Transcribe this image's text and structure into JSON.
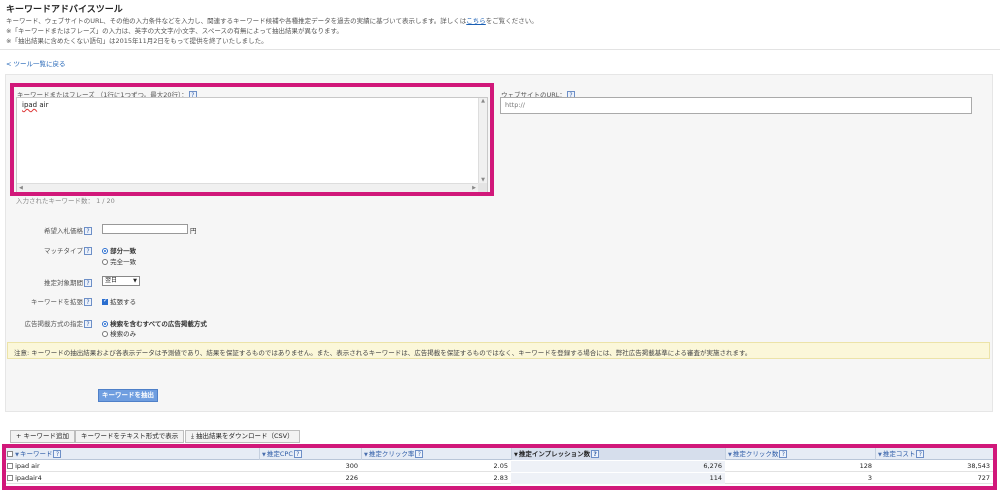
{
  "header": {
    "title": "キーワードアドバイスツール",
    "desc1": "キーワード、ウェブサイトのURL、その他の入力条件などを入力し、関連するキーワード候補や各種推定データを過去の実績に基づいて表示します。詳しくは",
    "desc1_link": "こちら",
    "desc1_tail": "をご覧ください。",
    "desc2": "※「キーワードまたはフレーズ」の入力は、英字の大文字/小文字、スペースの有無によって抽出結果が異なります。",
    "desc3": "※「抽出結果に含めたくない語句」は2015年11月2日をもって提供を終了いたしました。",
    "back_link": "< ツール一覧に戻る"
  },
  "keyword_input": {
    "label": "キーワードまたはフレーズ （1行に1つずつ。最大20行）：",
    "help": "?",
    "value_underlined": "ipad",
    "value_rest": " air",
    "count_text": "入力されたキーワード数： 1 / 20"
  },
  "website": {
    "label": "ウェブサイトのURL：",
    "help": "?",
    "placeholder": "http://"
  },
  "form": {
    "bid_label": "希望入札価格",
    "bid_unit": "円",
    "match_label": "マッチタイプ",
    "match_partial": "部分一致",
    "match_exact": "完全一致",
    "period_label": "推定対象期間",
    "period_value": "翌日",
    "expand_label": "キーワードを拡張",
    "expand_option": "拡張する",
    "ad_format_label": "広告掲載方式の指定",
    "ad_format_all": "検索を含むすべての広告掲載方式",
    "ad_format_search": "検索のみ",
    "help": "?"
  },
  "notice": "注意: キーワードの抽出結果および各表示データは予測値であり、結果を保証するものではありません。また、表示されるキーワードは、広告掲載を保証するものではなく、キーワードを登録する場合には、弊社広告掲載基準による審査が実施されます。",
  "extract_button": "キーワードを抽出",
  "toolbar": {
    "add": "キーワード追加",
    "text_view": "キーワードをテキスト形式で表示",
    "download": "抽出結果をダウンロード（CSV）"
  },
  "table": {
    "headers": [
      "キーワード",
      "推定CPC",
      "推定クリック率",
      "推定インプレッション数",
      "推定クリック数",
      "推定コスト"
    ],
    "help": "?",
    "rows": [
      [
        "ipad air",
        "300",
        "2.05",
        "6,276",
        "128",
        "38,543"
      ],
      [
        "ipadair4",
        "226",
        "2.83",
        "114",
        "3",
        "727"
      ]
    ]
  },
  "colors": {
    "highlight": "#d1187a",
    "link": "#1a5fb4",
    "button": "#6f9ee0"
  }
}
